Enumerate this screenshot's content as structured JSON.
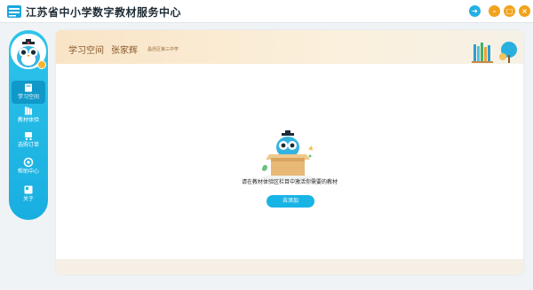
{
  "window": {
    "title": "江苏省中小学数字教材服务中心"
  },
  "sidebar": {
    "items": [
      {
        "label": "学习空间",
        "icon": "book-open-icon",
        "active": true
      },
      {
        "label": "教材体验",
        "icon": "books-icon",
        "active": false
      },
      {
        "label": "选购订单",
        "icon": "cart-icon",
        "active": false
      },
      {
        "label": "帮助中心",
        "icon": "help-icon",
        "active": false
      },
      {
        "label": "关于",
        "icon": "info-card-icon",
        "active": false
      }
    ]
  },
  "header": {
    "title": "学习空间",
    "user_name": "张家辉",
    "school": "昌邑区第三中学"
  },
  "empty_state": {
    "message": "请在教材体验区栏目中激活你需要的教材",
    "button_label": "去添加"
  },
  "colors": {
    "accent": "#19b4e6",
    "sidebar": "#18aee0",
    "window_control": "#f2a21b",
    "header_text": "#8a5a2d"
  }
}
